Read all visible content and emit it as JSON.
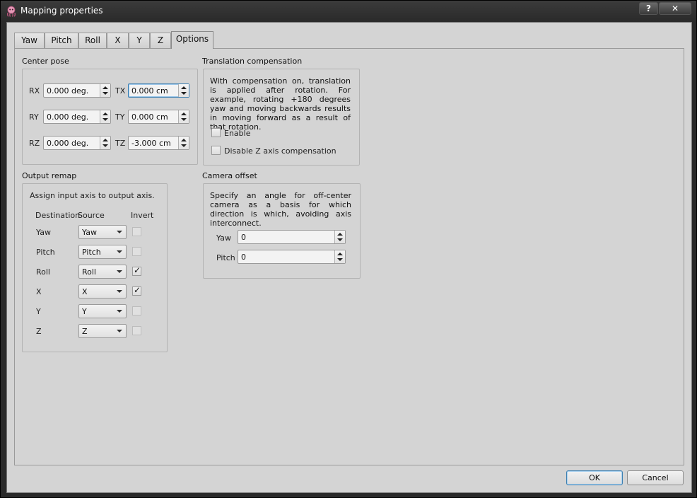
{
  "window": {
    "title": "Mapping properties",
    "help_label": "?",
    "close_label": "✕"
  },
  "tabs": [
    "Yaw",
    "Pitch",
    "Roll",
    "X",
    "Y",
    "Z",
    "Options"
  ],
  "active_tab": "Options",
  "center_pose": {
    "title": "Center pose",
    "rx_label": "RX",
    "rx_value": "0.000 deg.",
    "ry_label": "RY",
    "ry_value": "0.000 deg.",
    "rz_label": "RZ",
    "rz_value": "0.000 deg.",
    "tx_label": "TX",
    "tx_value": "0.000 cm",
    "ty_label": "TY",
    "ty_value": "0.000 cm",
    "tz_label": "TZ",
    "tz_value": "-3.000 cm"
  },
  "translation_compensation": {
    "title": "Translation compensation",
    "description": "With compensation on, translation is applied after rotation. For example, rotating +180 degrees yaw and moving backwards results in moving forward as a result of that rotation.",
    "enable_label": "Enable",
    "enable_checked": false,
    "disable_z_label": "Disable Z axis compensation",
    "disable_z_checked": false
  },
  "output_remap": {
    "title": "Output remap",
    "description": "Assign input axis to output axis.",
    "headers": {
      "destination": "Destination",
      "source": "Source",
      "invert": "Invert"
    },
    "rows": [
      {
        "destination": "Yaw",
        "source": "Yaw",
        "invert": false
      },
      {
        "destination": "Pitch",
        "source": "Pitch",
        "invert": false
      },
      {
        "destination": "Roll",
        "source": "Roll",
        "invert": true
      },
      {
        "destination": "X",
        "source": "X",
        "invert": true
      },
      {
        "destination": "Y",
        "source": "Y",
        "invert": false
      },
      {
        "destination": "Z",
        "source": "Z",
        "invert": false
      }
    ],
    "checkmark": "✓"
  },
  "camera_offset": {
    "title": "Camera offset",
    "description": "Specify an angle for off-center camera as a basis for which direction is which, avoiding axis interconnect.",
    "yaw_label": "Yaw",
    "yaw_value": "0",
    "pitch_label": "Pitch",
    "pitch_value": "0"
  },
  "buttons": {
    "ok": "OK",
    "cancel": "Cancel"
  }
}
